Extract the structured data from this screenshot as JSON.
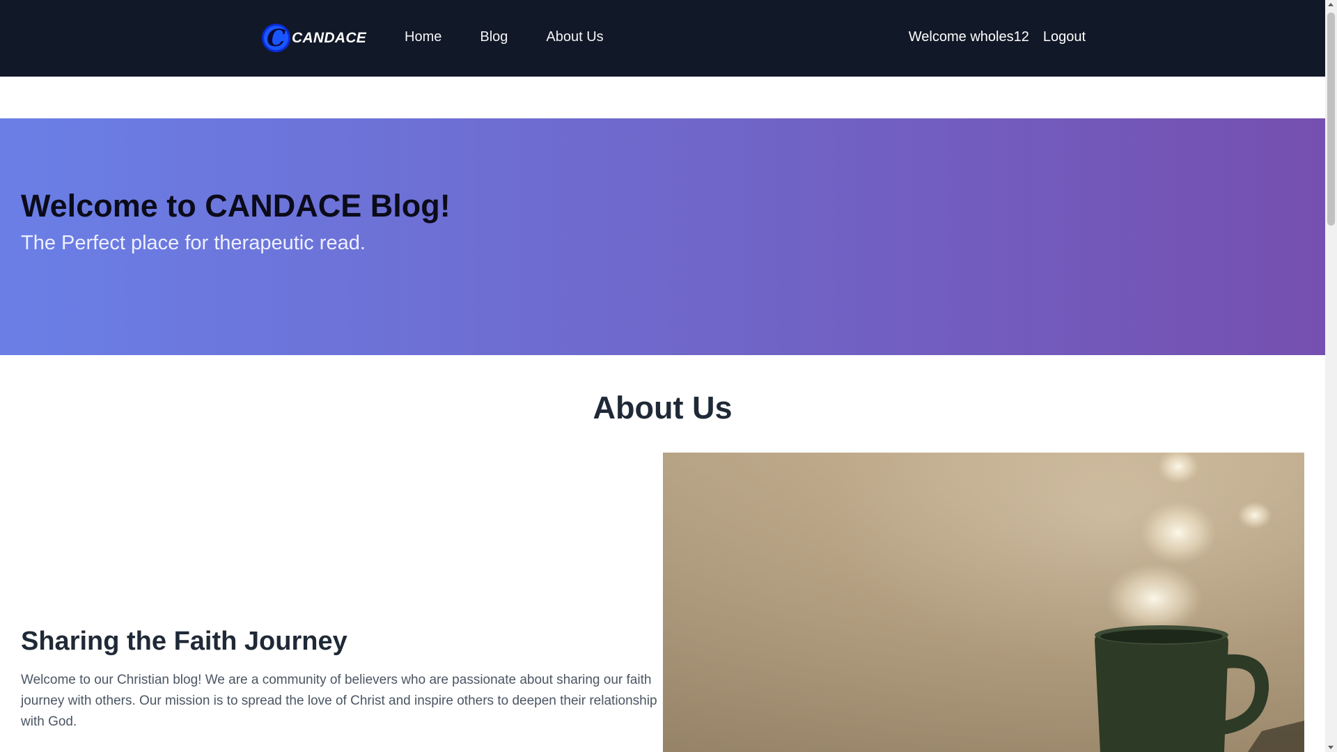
{
  "navbar": {
    "brand_logo_letter": "C",
    "brand_name": "CANDACE",
    "links": [
      {
        "label": "Home"
      },
      {
        "label": "Blog"
      },
      {
        "label": "About Us"
      }
    ],
    "welcome_text": "Welcome wholes12",
    "logout_label": "Logout",
    "background": "#111827"
  },
  "hero": {
    "title": "Welcome to CANDACE Blog!",
    "subtitle": "The Perfect place for therapeutic read.",
    "gradient_start": "#6a7fe6",
    "gradient_end": "#7550b0"
  },
  "about": {
    "heading": "About Us",
    "section_title": "Sharing the Faith Journey",
    "section_text": "Welcome to our Christian blog! We are a community of believers who are passionate about sharing our faith journey with others. Our mission is to spread the love of Christ and inspire others to deepen their relationship with God.",
    "image_icon": "coffee-mug-photo"
  }
}
